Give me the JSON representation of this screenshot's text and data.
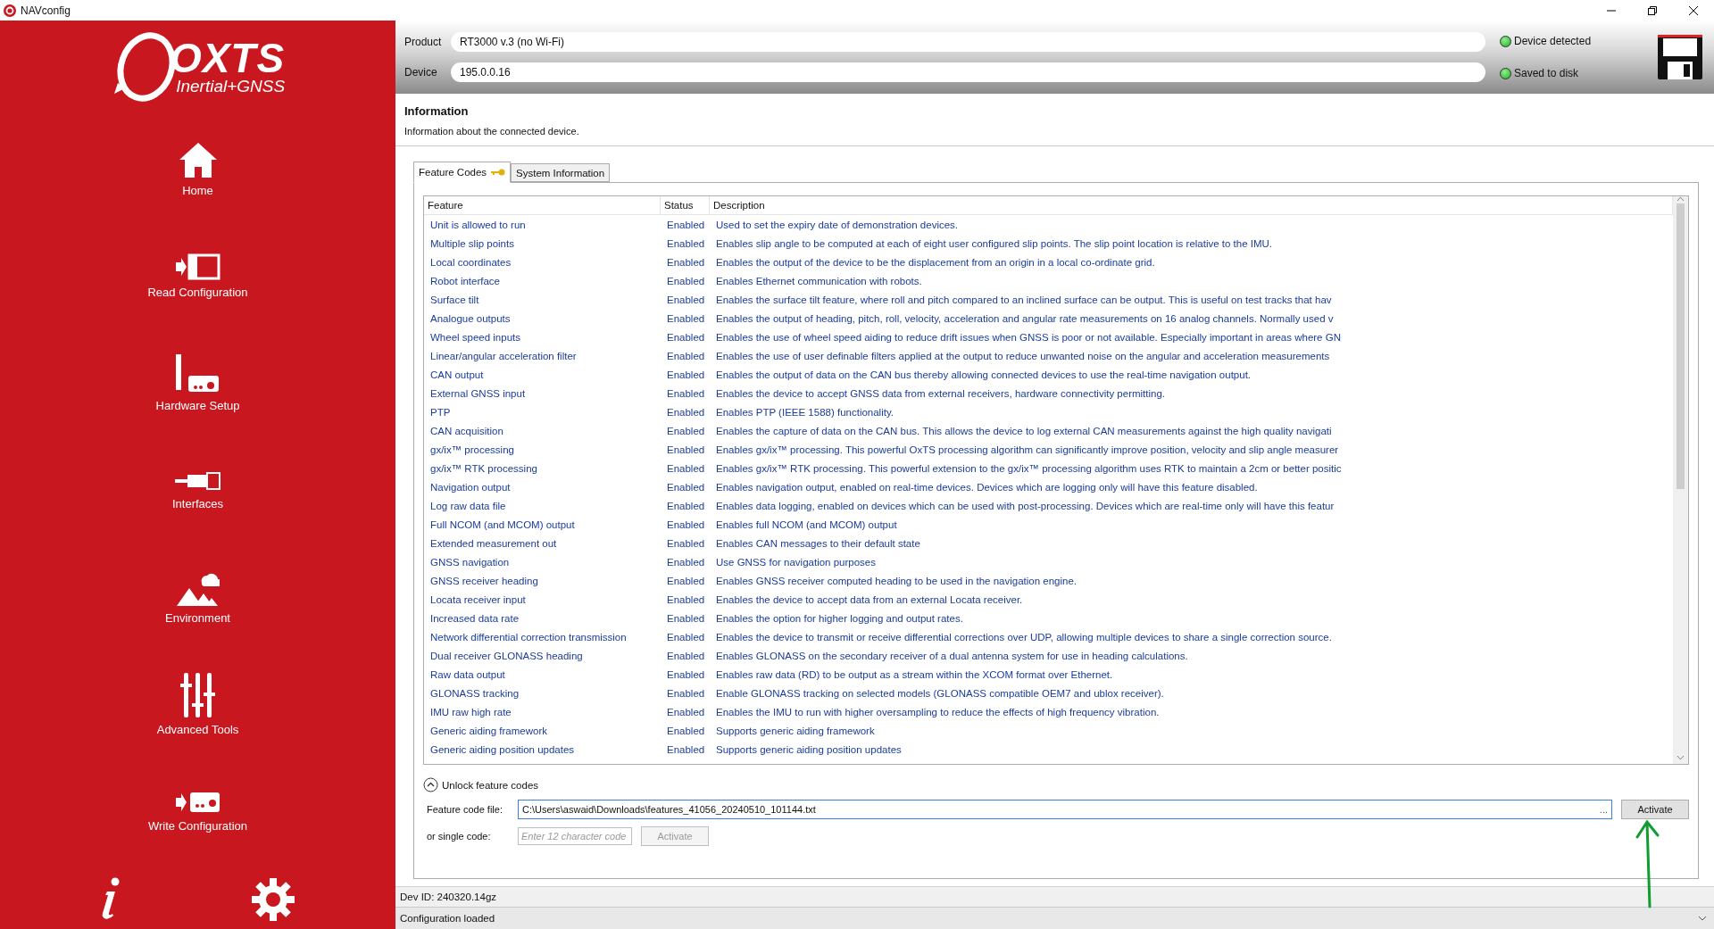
{
  "window": {
    "title": "NAVconfig"
  },
  "sidebar": {
    "logo": {
      "mark": "OXTS",
      "tagline": "Inertial+GNSS"
    },
    "items": [
      {
        "label": "Home",
        "kind": "home"
      },
      {
        "label": "Read Configuration",
        "kind": "read"
      },
      {
        "label": "Hardware Setup",
        "kind": "hardware"
      },
      {
        "label": "Interfaces",
        "kind": "interfaces"
      },
      {
        "label": "Environment",
        "kind": "environment"
      },
      {
        "label": "Advanced Tools",
        "kind": "tools"
      },
      {
        "label": "Write Configuration",
        "kind": "write"
      }
    ]
  },
  "header": {
    "fields": [
      {
        "label": "Product",
        "value": "RT3000 v.3 (no Wi-Fi)"
      },
      {
        "label": "Device",
        "value": "195.0.0.16"
      }
    ],
    "indicators": [
      {
        "label": "Device detected",
        "on": true
      },
      {
        "label": "Saved to disk",
        "on": true
      }
    ]
  },
  "page": {
    "title": "Information",
    "subtitle": "Information about the connected device."
  },
  "tabs": [
    {
      "label": "Feature Codes",
      "selected": true,
      "kind": "key"
    },
    {
      "label": "System Information",
      "selected": false,
      "kind": "plain"
    }
  ],
  "table": {
    "columns": [
      "Feature",
      "Status",
      "Description"
    ],
    "rows": [
      {
        "feature": "Unit is allowed to run",
        "status": "Enabled",
        "description": "Used to set the expiry date of demonstration devices."
      },
      {
        "feature": "Multiple slip points",
        "status": "Enabled",
        "description": "Enables slip angle to be computed at each of eight user configured slip points. The slip point location is relative to the IMU."
      },
      {
        "feature": "Local coordinates",
        "status": "Enabled",
        "description": "Enables the output of the device to be the displacement from an origin in a local co-ordinate grid."
      },
      {
        "feature": "Robot interface",
        "status": "Enabled",
        "description": "Enables Ethernet communication with robots."
      },
      {
        "feature": "Surface tilt",
        "status": "Enabled",
        "description": "Enables the surface tilt feature, where roll and pitch compared to an inclined surface can be output. This is useful on test tracks that hav"
      },
      {
        "feature": "Analogue outputs",
        "status": "Enabled",
        "description": "Enables the output of heading, pitch, roll, velocity, acceleration and angular rate measurements on 16 analog channels. Normally used v"
      },
      {
        "feature": "Wheel speed inputs",
        "status": "Enabled",
        "description": "Enables the use of wheel speed aiding to reduce drift issues when GNSS is poor or not available. Especially important in areas where GN"
      },
      {
        "feature": "Linear/angular acceleration filter",
        "status": "Enabled",
        "description": "Enables the use of user definable filters applied at the output to reduce unwanted noise on the angular and acceleration measurements"
      },
      {
        "feature": "CAN output",
        "status": "Enabled",
        "description": "Enables the output of data on the CAN bus thereby allowing connected devices to use the real-time navigation output."
      },
      {
        "feature": "External GNSS input",
        "status": "Enabled",
        "description": "Enables the device to accept GNSS data from external receivers, hardware connectivity permitting."
      },
      {
        "feature": "PTP",
        "status": "Enabled",
        "description": "Enables PTP (IEEE 1588) functionality."
      },
      {
        "feature": "CAN acquisition",
        "status": "Enabled",
        "description": "Enables the capture of data on the CAN bus. This allows the device to log external CAN measurements against the high quality navigati"
      },
      {
        "feature": "gx/ix™ processing",
        "status": "Enabled",
        "description": "Enables gx/ix™ processing. This powerful OxTS processing algorithm can significantly improve position, velocity and slip angle measurer"
      },
      {
        "feature": "gx/ix™ RTK processing",
        "status": "Enabled",
        "description": "Enables gx/ix™ RTK processing. This powerful extension to the gx/ix™ processing algorithm uses RTK to maintain a 2cm or better positic"
      },
      {
        "feature": "Navigation output",
        "status": "Enabled",
        "description": "Enables navigation output, enabled on real-time devices. Devices which are logging only will have this feature disabled."
      },
      {
        "feature": "Log raw data file",
        "status": "Enabled",
        "description": "Enables data logging, enabled on devices which can be used with post-processing. Devices which are real-time only will have this featur"
      },
      {
        "feature": "Full NCOM (and MCOM) output",
        "status": "Enabled",
        "description": "Enables full NCOM (and MCOM) output"
      },
      {
        "feature": "Extended measurement out",
        "status": "Enabled",
        "description": "Enables CAN messages to their default state"
      },
      {
        "feature": "GNSS navigation",
        "status": "Enabled",
        "description": "Use GNSS for navigation purposes"
      },
      {
        "feature": "GNSS receiver heading",
        "status": "Enabled",
        "description": "Enables GNSS receiver computed heading to be used in the navigation engine."
      },
      {
        "feature": "Locata receiver input",
        "status": "Enabled",
        "description": "Enables the device to accept data from an external Locata receiver."
      },
      {
        "feature": "Increased data rate",
        "status": "Enabled",
        "description": "Enables the option for higher logging and output rates."
      },
      {
        "feature": "Network differential correction transmission",
        "status": "Enabled",
        "description": "Enables the device to transmit or receive differential corrections over UDP, allowing multiple devices to share a single correction source."
      },
      {
        "feature": "Dual receiver GLONASS heading",
        "status": "Enabled",
        "description": "Enables GLONASS on the secondary receiver of a dual antenna system for use in heading calculations."
      },
      {
        "feature": "Raw data output",
        "status": "Enabled",
        "description": "Enables raw data (RD) to be output as a stream within the XCOM format over Ethernet."
      },
      {
        "feature": "GLONASS tracking",
        "status": "Enabled",
        "description": "Enable GLONASS tracking on selected models (GLONASS compatible OEM7 and ublox receiver)."
      },
      {
        "feature": "IMU raw high rate",
        "status": "Enabled",
        "description": "Enables the IMU to run with higher oversampling to reduce the effects of high frequency vibration."
      },
      {
        "feature": "Generic aiding framework",
        "status": "Enabled",
        "description": "Supports generic aiding framework"
      },
      {
        "feature": "Generic aiding position updates",
        "status": "Enabled",
        "description": "Supports generic aiding position updates"
      }
    ]
  },
  "unlock": {
    "title": "Unlock feature codes",
    "expanded": true,
    "file_label": "Feature code file:",
    "file_value": "C:\\Users\\aswaid\\Downloads\\features_41056_20240510_101144.txt",
    "browse": "...",
    "file_activate": {
      "label": "Activate",
      "disabled": false
    },
    "code_label": "or single code:",
    "code_placeholder": "Enter 12 character code",
    "code_activate": {
      "label": "Activate",
      "disabled": true
    }
  },
  "status_bar": {
    "dev_id": "Dev ID: 240320.14gz",
    "message": "Configuration loaded"
  }
}
